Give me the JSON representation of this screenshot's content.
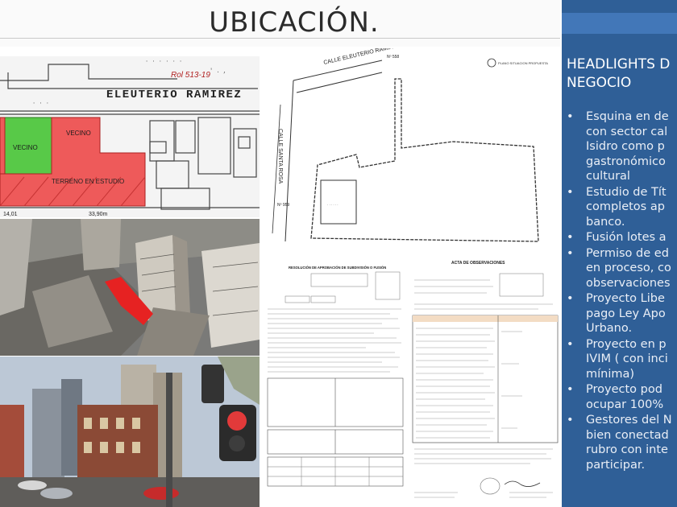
{
  "header": {
    "title": "UBICACIÓN."
  },
  "site_plan": {
    "street": "ELEUTERIO RAMIREZ",
    "rol": "Rol 513-19",
    "neighbor_1": "VECINO",
    "neighbor_2": "VECINO",
    "lot_label": "TERRENO EN ESTUDIO",
    "dim_left": "14,01",
    "dim_right": "33,90m"
  },
  "survey_plan": {
    "street_top": "CALLE ELEUTERIO RAMIREZ",
    "street_number": "Nº 558",
    "street_side": "CALLE SANTA ROSA",
    "side_number": "Nº 959",
    "title_block": "PLANO SITUACION PROPUESTA"
  },
  "form_document": {
    "title": "RESOLUCIÓN DE APROBACIÓN DE SUBDIVISIÓN O FUSIÓN"
  },
  "observations_document": {
    "title": "ACTA DE OBSERVACIONES"
  },
  "sidebar": {
    "heading_lines": [
      "HEADLIGHTS D",
      "NEGOCIO"
    ],
    "bullets": [
      {
        "lines": [
          "Esquina en de",
          "con sector cal",
          "Isidro como p",
          "gastronómico",
          "cultural"
        ]
      },
      {
        "lines": [
          "Estudio de Tít",
          "completos ap",
          "banco."
        ]
      },
      {
        "lines": [
          "Fusión lotes a"
        ]
      },
      {
        "lines": [
          "Permiso de ed",
          "en proceso, co",
          "observaciones"
        ]
      },
      {
        "lines": [
          "Proyecto Libe",
          "pago Ley Apo",
          "Urbano."
        ]
      },
      {
        "lines": [
          "Proyecto en p",
          "IVIM ( con inci",
          "mínima)"
        ]
      },
      {
        "lines": [
          "Proyecto pod",
          "ocupar 100%"
        ]
      },
      {
        "lines": [
          "Gestores del N",
          "bien conectad",
          "rubro con inte",
          "participar."
        ]
      }
    ]
  },
  "colors": {
    "sidebar_bg": "#2f5f97",
    "sidebar_accent": "#4277b8",
    "neighbor_green": "#58c948",
    "lot_red": "#ee5a5a"
  }
}
